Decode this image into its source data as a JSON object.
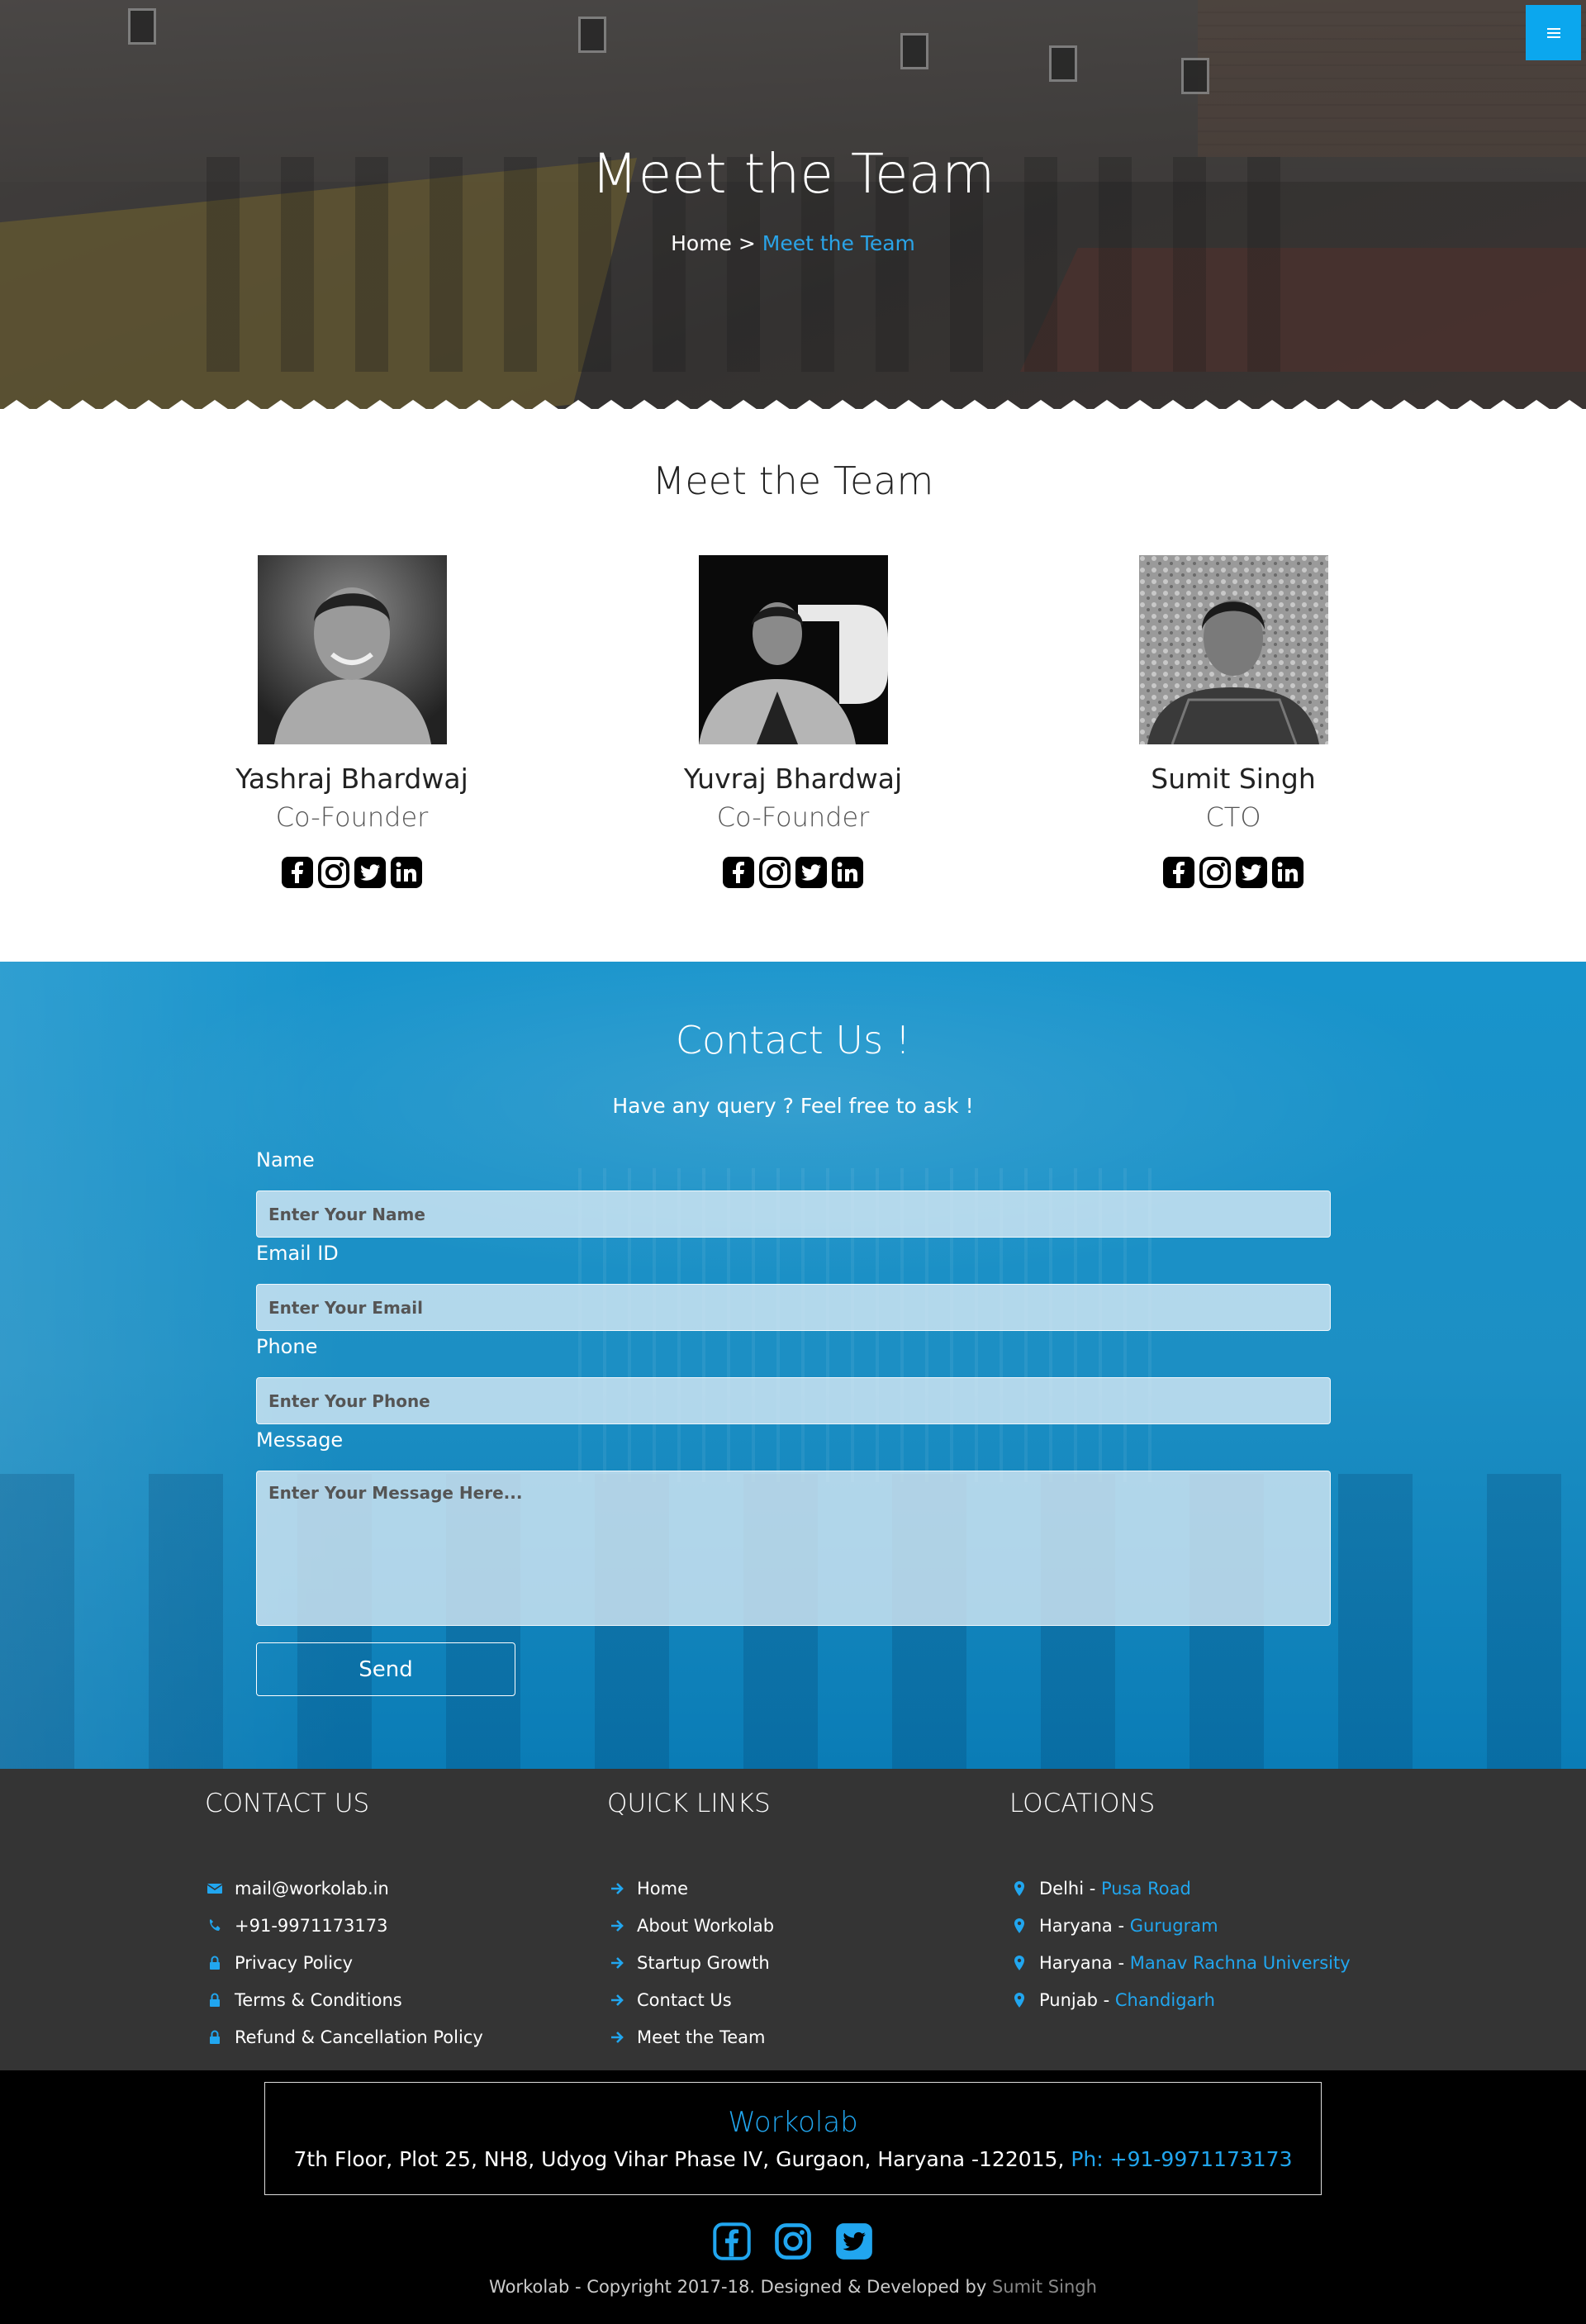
{
  "hero": {
    "title": "Meet the Team",
    "breadcrumb_home": "Home",
    "breadcrumb_sep": " > ",
    "breadcrumb_current": "Meet the Team"
  },
  "menu": {
    "icon": "menu-bars-icon",
    "color": "#0ba7ee"
  },
  "team": {
    "title": "Meet the Team",
    "members": [
      {
        "name": "Yashraj Bhardwaj",
        "role": "Co-Founder"
      },
      {
        "name": "Yuvraj Bhardwaj",
        "role": "Co-Founder"
      },
      {
        "name": "Sumit Singh",
        "role": "CTO"
      }
    ],
    "social_icons": [
      "facebook-icon",
      "instagram-icon",
      "twitter-icon",
      "linkedin-icon"
    ]
  },
  "contact": {
    "title": "Contact Us !",
    "subtitle": "Have any query ? Feel free to ask !",
    "name_label": "Name",
    "name_placeholder": "Enter Your Name",
    "email_label": "Email ID",
    "email_placeholder": "Enter Your Email",
    "phone_label": "Phone",
    "phone_placeholder": "Enter Your Phone",
    "message_label": "Message",
    "message_placeholder": "Enter Your Message Here...",
    "send_label": "Send"
  },
  "footer": {
    "contact_title": "CONTACT US",
    "contact_items": [
      {
        "icon": "envelope-icon",
        "text": "mail@workolab.in"
      },
      {
        "icon": "phone-icon",
        "text": "+91-9971173173"
      },
      {
        "icon": "lock-icon",
        "text": "Privacy Policy"
      },
      {
        "icon": "lock-icon",
        "text": "Terms & Conditions"
      },
      {
        "icon": "lock-icon",
        "text": "Refund & Cancellation Policy"
      }
    ],
    "links_title": "QUICK LINKS",
    "links": [
      "Home",
      "About Workolab",
      "Startup Growth",
      "Contact Us",
      "Meet the Team"
    ],
    "locations_title": "LOCATIONS",
    "locations": [
      {
        "state": "Delhi",
        "place": "Pusa Road"
      },
      {
        "state": "Haryana",
        "place": "Gurugram"
      },
      {
        "state": "Haryana",
        "place": "Manav Rachna University"
      },
      {
        "state": "Punjab",
        "place": "Chandigarh"
      }
    ],
    "location_sep": " - "
  },
  "bottom": {
    "brand": "Workolab",
    "address": "7th Floor, Plot 25, NH8, Udyog Vihar Phase IV, Gurgaon, Haryana -122015, ",
    "phone": "Ph: +91-9971173173",
    "copyright": "Workolab - Copyright 2017-18. Designed & Developed by ",
    "developer": "Sumit Singh"
  },
  "colors": {
    "accent": "#21a6ef",
    "footer_bg": "#343434",
    "bottom_bg": "#000000",
    "contact_bg": "#1894cc"
  }
}
